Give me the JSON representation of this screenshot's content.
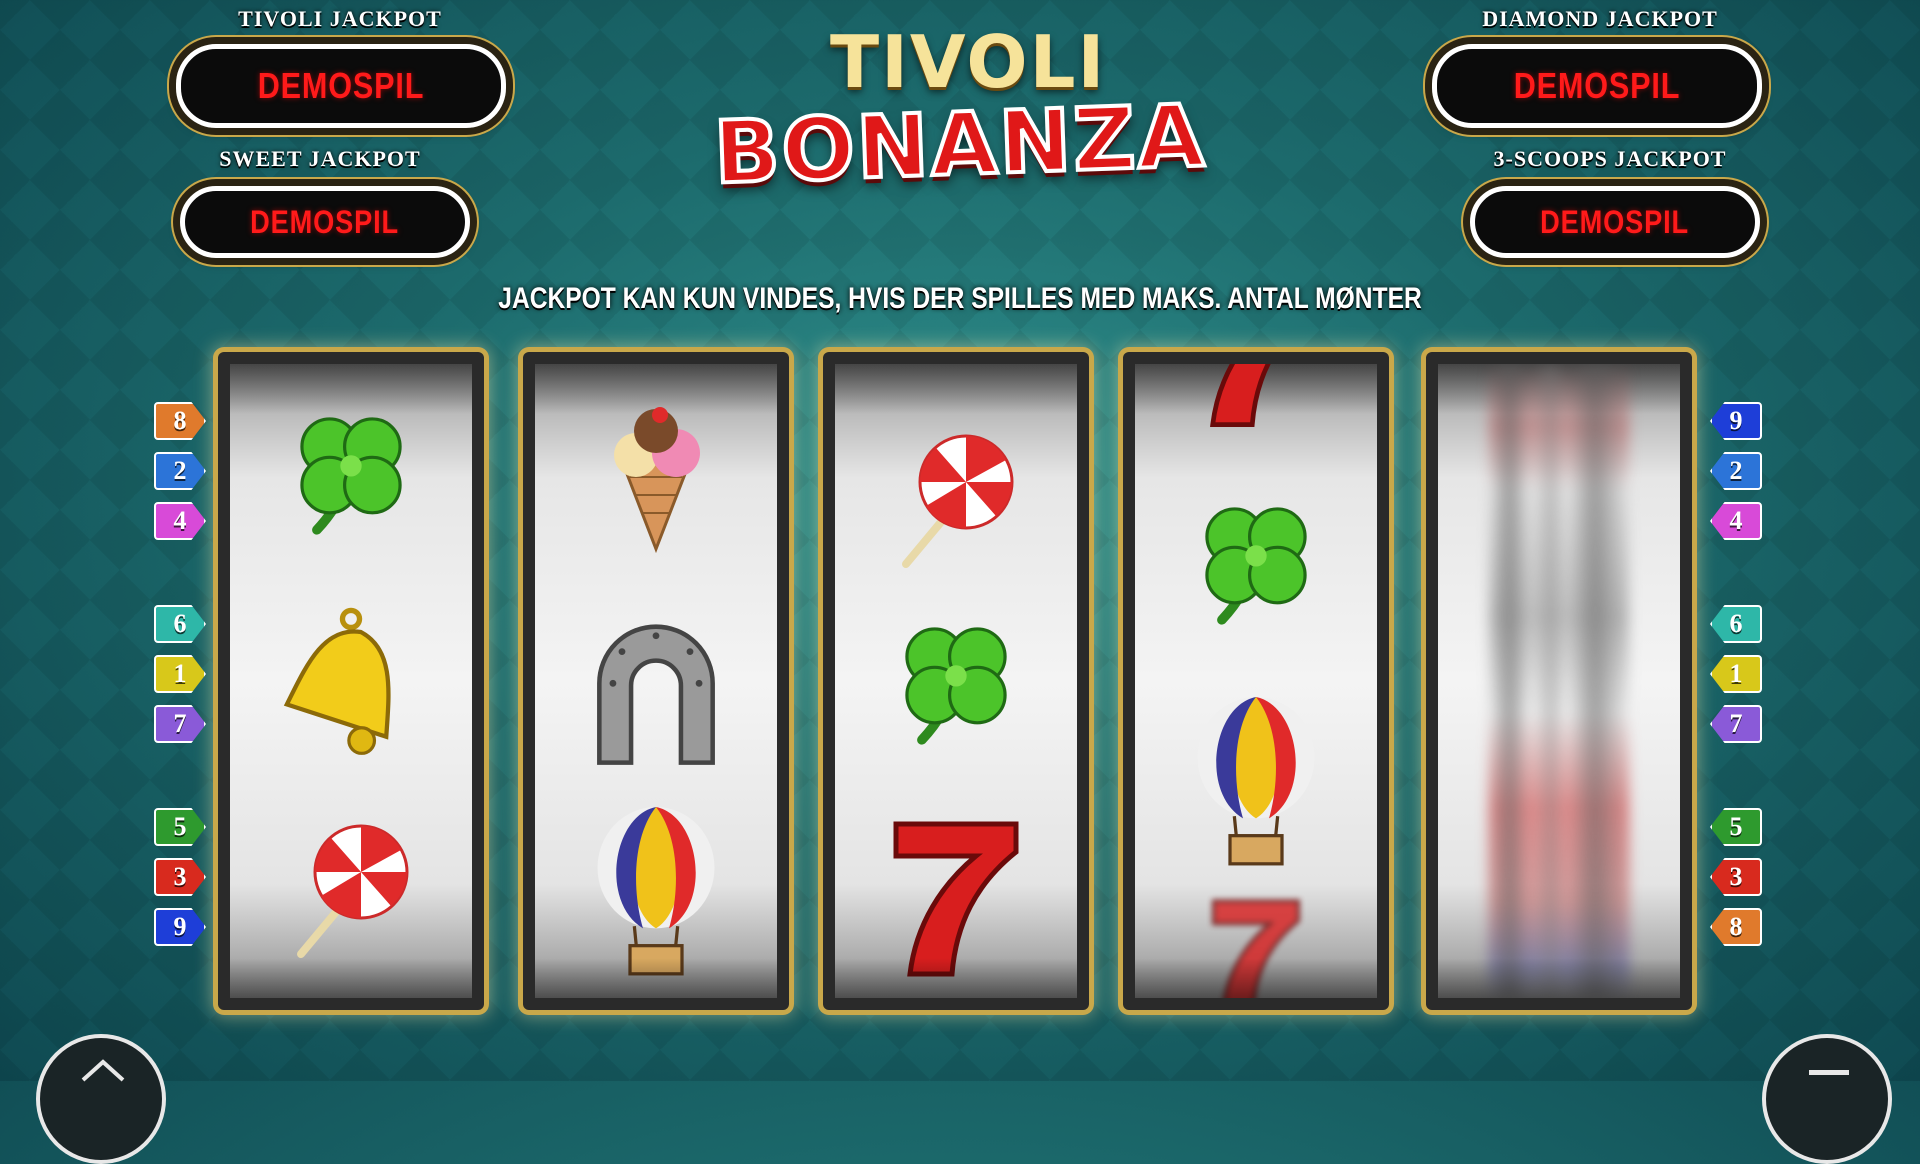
{
  "jackpots": {
    "tivoli": {
      "title": "TIVOLI JACKPOT",
      "value": "DEMOSPIL"
    },
    "sweet": {
      "title": "SWEET JACKPOT",
      "value": "DEMOSPIL"
    },
    "diamond": {
      "title": "DIAMOND JACKPOT",
      "value": "DEMOSPIL"
    },
    "scoops": {
      "title": "3-SCOOPS JACKPOT",
      "value": "DEMOSPIL"
    }
  },
  "logo": {
    "line1": "TIVOLI",
    "line2": "BONANZA"
  },
  "notice": "JACKPOT KAN KUN VINDES, HVIS DER SPILLES MED MAKS. ANTAL MØNTER",
  "reels": [
    [
      "clover-icon",
      "bell-icon",
      "lollipop-icon"
    ],
    [
      "ice-cream-icon",
      "horseshoe-icon",
      "balloon-icon"
    ],
    [
      "lollipop-icon",
      "clover-icon",
      "seven-icon"
    ],
    [
      "seven-icon",
      "clover-icon",
      "balloon-icon",
      "seven-icon"
    ],
    [
      "spinning-blur"
    ]
  ],
  "paylines_left": [
    {
      "n": "8",
      "color": "#e07a2c"
    },
    {
      "n": "2",
      "color": "#2c74d8"
    },
    {
      "n": "4",
      "color": "#d84ad8"
    },
    {
      "n": "6",
      "color": "#2eb7a8"
    },
    {
      "n": "1",
      "color": "#d8c81a"
    },
    {
      "n": "7",
      "color": "#8a5ad8"
    },
    {
      "n": "5",
      "color": "#2e9a2e"
    },
    {
      "n": "3",
      "color": "#d82a1e"
    },
    {
      "n": "9",
      "color": "#1e3ed8"
    }
  ],
  "paylines_right": [
    {
      "n": "9",
      "color": "#1e3ed8"
    },
    {
      "n": "2",
      "color": "#2c74d8"
    },
    {
      "n": "4",
      "color": "#d84ad8"
    },
    {
      "n": "6",
      "color": "#2eb7a8"
    },
    {
      "n": "1",
      "color": "#d8c81a"
    },
    {
      "n": "7",
      "color": "#8a5ad8"
    },
    {
      "n": "5",
      "color": "#2e9a2e"
    },
    {
      "n": "3",
      "color": "#d82a1e"
    },
    {
      "n": "8",
      "color": "#e07a2c"
    }
  ],
  "controls": {
    "home": "home-icon",
    "menu": "menu-icon"
  }
}
